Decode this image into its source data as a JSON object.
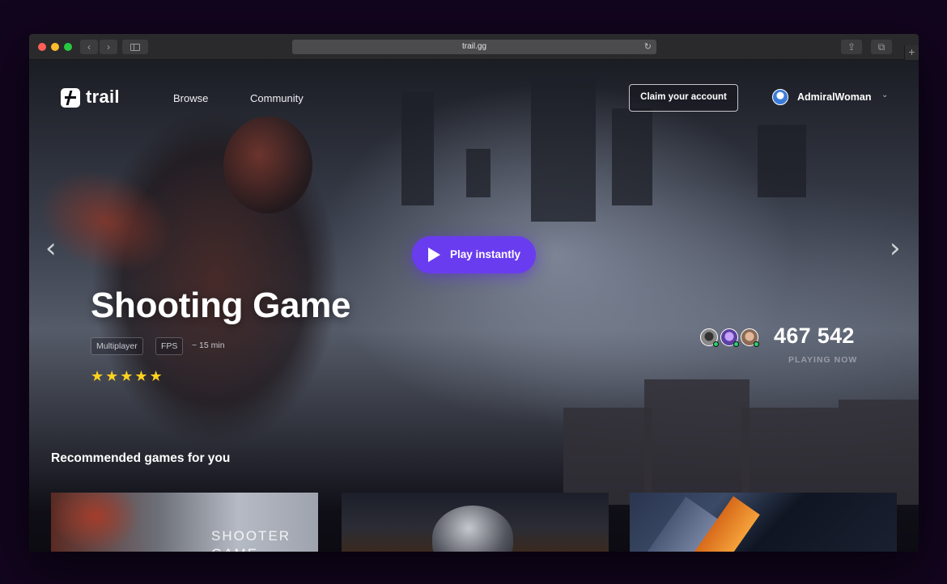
{
  "browser": {
    "url": "trail.gg",
    "nav_back": "‹",
    "nav_forward": "›",
    "reload": "↻",
    "share": "⇪",
    "tabs": "⧉",
    "new_tab": "+"
  },
  "header": {
    "logo_text": "trail",
    "nav": {
      "browse": "Browse",
      "community": "Community"
    },
    "claim_button": "Claim your account",
    "username": "AdmiralWoman",
    "user_menu_icon": "chevron-down-icon"
  },
  "hero": {
    "prev": "‹",
    "next": "›",
    "play_button": "Play instantly",
    "title": "Shooting Game",
    "tags": [
      "Multiplayer",
      "FPS"
    ],
    "duration": "~ 15 min",
    "rating": 5,
    "stars": "★★★★★",
    "players_count": "467 542",
    "players_label": "PLAYING NOW"
  },
  "recommended": {
    "title": "Recommended games for you",
    "cards": [
      {
        "label": "SHOOTER GAME"
      },
      {
        "label": ""
      },
      {
        "label": ""
      }
    ]
  },
  "colors": {
    "accent": "#6a3cf0",
    "star": "#ffd21e",
    "online": "#2bd16d",
    "background": "#0c0b12"
  }
}
